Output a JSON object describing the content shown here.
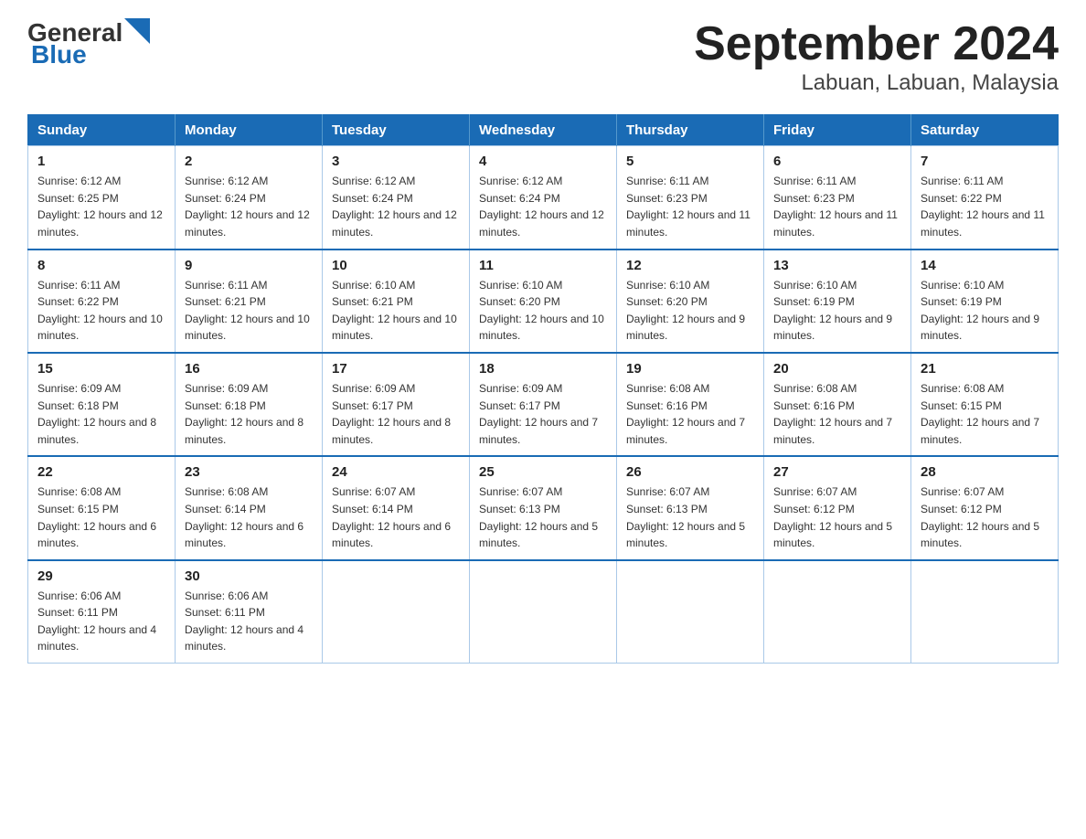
{
  "header": {
    "logo_general": "General",
    "logo_blue": "Blue",
    "title": "September 2024",
    "subtitle": "Labuan, Labuan, Malaysia"
  },
  "weekdays": [
    "Sunday",
    "Monday",
    "Tuesday",
    "Wednesday",
    "Thursday",
    "Friday",
    "Saturday"
  ],
  "weeks": [
    [
      {
        "day": "1",
        "sunrise": "6:12 AM",
        "sunset": "6:25 PM",
        "daylight": "12 hours and 12 minutes."
      },
      {
        "day": "2",
        "sunrise": "6:12 AM",
        "sunset": "6:24 PM",
        "daylight": "12 hours and 12 minutes."
      },
      {
        "day": "3",
        "sunrise": "6:12 AM",
        "sunset": "6:24 PM",
        "daylight": "12 hours and 12 minutes."
      },
      {
        "day": "4",
        "sunrise": "6:12 AM",
        "sunset": "6:24 PM",
        "daylight": "12 hours and 12 minutes."
      },
      {
        "day": "5",
        "sunrise": "6:11 AM",
        "sunset": "6:23 PM",
        "daylight": "12 hours and 11 minutes."
      },
      {
        "day": "6",
        "sunrise": "6:11 AM",
        "sunset": "6:23 PM",
        "daylight": "12 hours and 11 minutes."
      },
      {
        "day": "7",
        "sunrise": "6:11 AM",
        "sunset": "6:22 PM",
        "daylight": "12 hours and 11 minutes."
      }
    ],
    [
      {
        "day": "8",
        "sunrise": "6:11 AM",
        "sunset": "6:22 PM",
        "daylight": "12 hours and 10 minutes."
      },
      {
        "day": "9",
        "sunrise": "6:11 AM",
        "sunset": "6:21 PM",
        "daylight": "12 hours and 10 minutes."
      },
      {
        "day": "10",
        "sunrise": "6:10 AM",
        "sunset": "6:21 PM",
        "daylight": "12 hours and 10 minutes."
      },
      {
        "day": "11",
        "sunrise": "6:10 AM",
        "sunset": "6:20 PM",
        "daylight": "12 hours and 10 minutes."
      },
      {
        "day": "12",
        "sunrise": "6:10 AM",
        "sunset": "6:20 PM",
        "daylight": "12 hours and 9 minutes."
      },
      {
        "day": "13",
        "sunrise": "6:10 AM",
        "sunset": "6:19 PM",
        "daylight": "12 hours and 9 minutes."
      },
      {
        "day": "14",
        "sunrise": "6:10 AM",
        "sunset": "6:19 PM",
        "daylight": "12 hours and 9 minutes."
      }
    ],
    [
      {
        "day": "15",
        "sunrise": "6:09 AM",
        "sunset": "6:18 PM",
        "daylight": "12 hours and 8 minutes."
      },
      {
        "day": "16",
        "sunrise": "6:09 AM",
        "sunset": "6:18 PM",
        "daylight": "12 hours and 8 minutes."
      },
      {
        "day": "17",
        "sunrise": "6:09 AM",
        "sunset": "6:17 PM",
        "daylight": "12 hours and 8 minutes."
      },
      {
        "day": "18",
        "sunrise": "6:09 AM",
        "sunset": "6:17 PM",
        "daylight": "12 hours and 7 minutes."
      },
      {
        "day": "19",
        "sunrise": "6:08 AM",
        "sunset": "6:16 PM",
        "daylight": "12 hours and 7 minutes."
      },
      {
        "day": "20",
        "sunrise": "6:08 AM",
        "sunset": "6:16 PM",
        "daylight": "12 hours and 7 minutes."
      },
      {
        "day": "21",
        "sunrise": "6:08 AM",
        "sunset": "6:15 PM",
        "daylight": "12 hours and 7 minutes."
      }
    ],
    [
      {
        "day": "22",
        "sunrise": "6:08 AM",
        "sunset": "6:15 PM",
        "daylight": "12 hours and 6 minutes."
      },
      {
        "day": "23",
        "sunrise": "6:08 AM",
        "sunset": "6:14 PM",
        "daylight": "12 hours and 6 minutes."
      },
      {
        "day": "24",
        "sunrise": "6:07 AM",
        "sunset": "6:14 PM",
        "daylight": "12 hours and 6 minutes."
      },
      {
        "day": "25",
        "sunrise": "6:07 AM",
        "sunset": "6:13 PM",
        "daylight": "12 hours and 5 minutes."
      },
      {
        "day": "26",
        "sunrise": "6:07 AM",
        "sunset": "6:13 PM",
        "daylight": "12 hours and 5 minutes."
      },
      {
        "day": "27",
        "sunrise": "6:07 AM",
        "sunset": "6:12 PM",
        "daylight": "12 hours and 5 minutes."
      },
      {
        "day": "28",
        "sunrise": "6:07 AM",
        "sunset": "6:12 PM",
        "daylight": "12 hours and 5 minutes."
      }
    ],
    [
      {
        "day": "29",
        "sunrise": "6:06 AM",
        "sunset": "6:11 PM",
        "daylight": "12 hours and 4 minutes."
      },
      {
        "day": "30",
        "sunrise": "6:06 AM",
        "sunset": "6:11 PM",
        "daylight": "12 hours and 4 minutes."
      },
      null,
      null,
      null,
      null,
      null
    ]
  ],
  "labels": {
    "sunrise": "Sunrise:",
    "sunset": "Sunset:",
    "daylight": "Daylight:"
  }
}
